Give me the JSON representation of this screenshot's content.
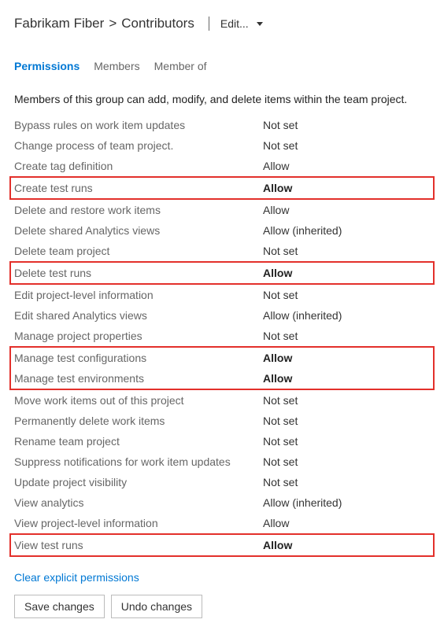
{
  "breadcrumb": {
    "project": "Fabrikam Fiber",
    "group": "Contributors"
  },
  "edit": {
    "label": "Edit..."
  },
  "tabs": [
    {
      "label": "Permissions",
      "active": true
    },
    {
      "label": "Members",
      "active": false
    },
    {
      "label": "Member of",
      "active": false
    }
  ],
  "description": "Members of this group can add, modify, and delete items within the team project.",
  "permissions": [
    {
      "label": "Bypass rules on work item updates",
      "value": "Not set",
      "highlight": false,
      "groupStart": false,
      "groupEnd": false
    },
    {
      "label": "Change process of team project.",
      "value": "Not set",
      "highlight": false,
      "groupStart": false,
      "groupEnd": false
    },
    {
      "label": "Create tag definition",
      "value": "Allow",
      "highlight": false,
      "groupStart": false,
      "groupEnd": false
    },
    {
      "label": "Create test runs",
      "value": "Allow",
      "highlight": true,
      "groupStart": true,
      "groupEnd": true
    },
    {
      "label": "Delete and restore work items",
      "value": "Allow",
      "highlight": false,
      "groupStart": false,
      "groupEnd": false
    },
    {
      "label": "Delete shared Analytics views",
      "value": "Allow (inherited)",
      "highlight": false,
      "groupStart": false,
      "groupEnd": false
    },
    {
      "label": "Delete team project",
      "value": "Not set",
      "highlight": false,
      "groupStart": false,
      "groupEnd": false
    },
    {
      "label": "Delete test runs",
      "value": "Allow",
      "highlight": true,
      "groupStart": true,
      "groupEnd": true
    },
    {
      "label": "Edit project-level information",
      "value": "Not set",
      "highlight": false,
      "groupStart": false,
      "groupEnd": false
    },
    {
      "label": "Edit shared Analytics views",
      "value": "Allow (inherited)",
      "highlight": false,
      "groupStart": false,
      "groupEnd": false
    },
    {
      "label": "Manage project properties",
      "value": "Not set",
      "highlight": false,
      "groupStart": false,
      "groupEnd": false
    },
    {
      "label": "Manage test configurations",
      "value": "Allow",
      "highlight": true,
      "groupStart": true,
      "groupEnd": false
    },
    {
      "label": "Manage test environments",
      "value": "Allow",
      "highlight": true,
      "groupStart": false,
      "groupEnd": true
    },
    {
      "label": "Move work items out of this project",
      "value": "Not set",
      "highlight": false,
      "groupStart": false,
      "groupEnd": false
    },
    {
      "label": "Permanently delete work items",
      "value": "Not set",
      "highlight": false,
      "groupStart": false,
      "groupEnd": false
    },
    {
      "label": "Rename team project",
      "value": "Not set",
      "highlight": false,
      "groupStart": false,
      "groupEnd": false
    },
    {
      "label": "Suppress notifications for work item updates",
      "value": "Not set",
      "highlight": false,
      "groupStart": false,
      "groupEnd": false
    },
    {
      "label": "Update project visibility",
      "value": "Not set",
      "highlight": false,
      "groupStart": false,
      "groupEnd": false
    },
    {
      "label": "View analytics",
      "value": "Allow (inherited)",
      "highlight": false,
      "groupStart": false,
      "groupEnd": false
    },
    {
      "label": "View project-level information",
      "value": "Allow",
      "highlight": false,
      "groupStart": false,
      "groupEnd": false
    },
    {
      "label": "View test runs",
      "value": "Allow",
      "highlight": true,
      "groupStart": true,
      "groupEnd": true
    }
  ],
  "actions": {
    "clear": "Clear explicit permissions",
    "save": "Save changes",
    "undo": "Undo changes"
  }
}
